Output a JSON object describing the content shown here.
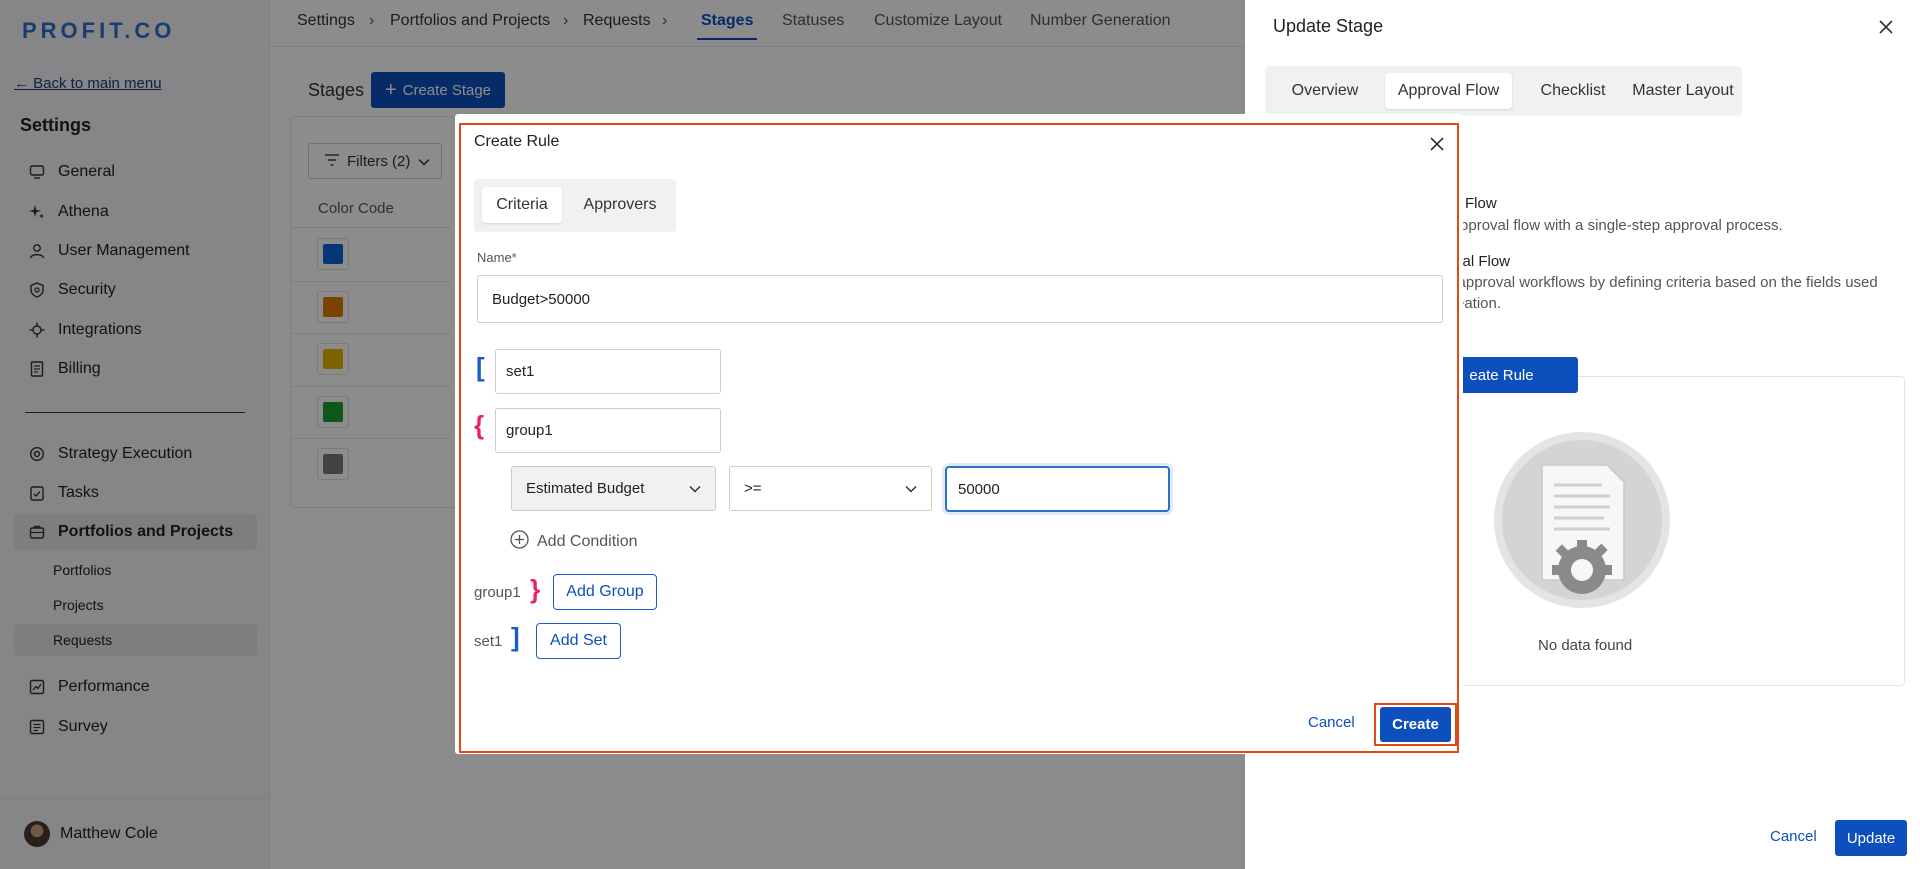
{
  "sidebar": {
    "logo": "PROFIT.CO",
    "back_link": "← Back to main menu",
    "title": "Settings",
    "items": [
      {
        "label": "General",
        "icon": "monitor-icon"
      },
      {
        "label": "Athena",
        "icon": "sparkle-icon"
      },
      {
        "label": "User Management",
        "icon": "user-icon"
      },
      {
        "label": "Security",
        "icon": "shield-icon"
      },
      {
        "label": "Integrations",
        "icon": "integrations-icon"
      },
      {
        "label": "Billing",
        "icon": "billing-icon"
      },
      {
        "label": "Strategy Execution",
        "icon": "target-icon"
      },
      {
        "label": "Tasks",
        "icon": "task-icon"
      },
      {
        "label": "Portfolios and Projects",
        "icon": "briefcase-icon"
      },
      {
        "label": "Performance",
        "icon": "performance-icon"
      },
      {
        "label": "Survey",
        "icon": "survey-icon"
      }
    ],
    "sub_items": [
      "Portfolios",
      "Projects",
      "Requests"
    ],
    "active_item": "Portfolios and Projects",
    "active_sub_item": "Requests",
    "user_name": "Matthew Cole"
  },
  "topnav": {
    "breadcrumbs": [
      "Settings",
      "Portfolios and Projects",
      "Requests"
    ],
    "tabs": [
      "Stages",
      "Statuses",
      "Customize Layout",
      "Number Generation"
    ],
    "active_tab": "Stages"
  },
  "main": {
    "title": "Stages",
    "create_button": "Create Stage",
    "filters_button": "Filters (2)",
    "column_header": "Color Code",
    "color_codes": [
      "#0b63d8",
      "#e07b00",
      "#e2b800",
      "#1f9d32",
      "#787878"
    ]
  },
  "drawer": {
    "title": "Update Stage",
    "tabs": [
      "Overview",
      "Approval Flow",
      "Checklist",
      "Master Layout"
    ],
    "active_tab": "Approval Flow",
    "option1_title": "Flow",
    "option1_desc": "c approval flow with a single-step approval process.",
    "option2_title": "val Flow",
    "option2_desc_line1": "n approval workflows by defining criteria based on the fields used",
    "option2_desc_line2": "reation.",
    "create_rule_button": "eate Rule",
    "empty_text": "No data found",
    "cancel_button": "Cancel",
    "update_button": "Update"
  },
  "modal": {
    "title": "Create Rule",
    "tabs": [
      "Criteria",
      "Approvers"
    ],
    "active_tab": "Criteria",
    "name_label": "Name*",
    "name_value": "Budget>50000",
    "set_name": "set1",
    "group_name": "group1",
    "condition": {
      "field": "Estimated Budget",
      "operator": ">=",
      "value": "50000"
    },
    "add_condition": "Add Condition",
    "group_close_label": "group1",
    "add_group": "Add Group",
    "set_close_label": "set1",
    "add_set": "Add Set",
    "cancel_button": "Cancel",
    "create_button": "Create"
  },
  "colors": {
    "accent": "#0d4fbd",
    "highlight": "#e04a16",
    "bracket_blue": "#1a5dc8",
    "bracket_pink": "#e8226a"
  }
}
